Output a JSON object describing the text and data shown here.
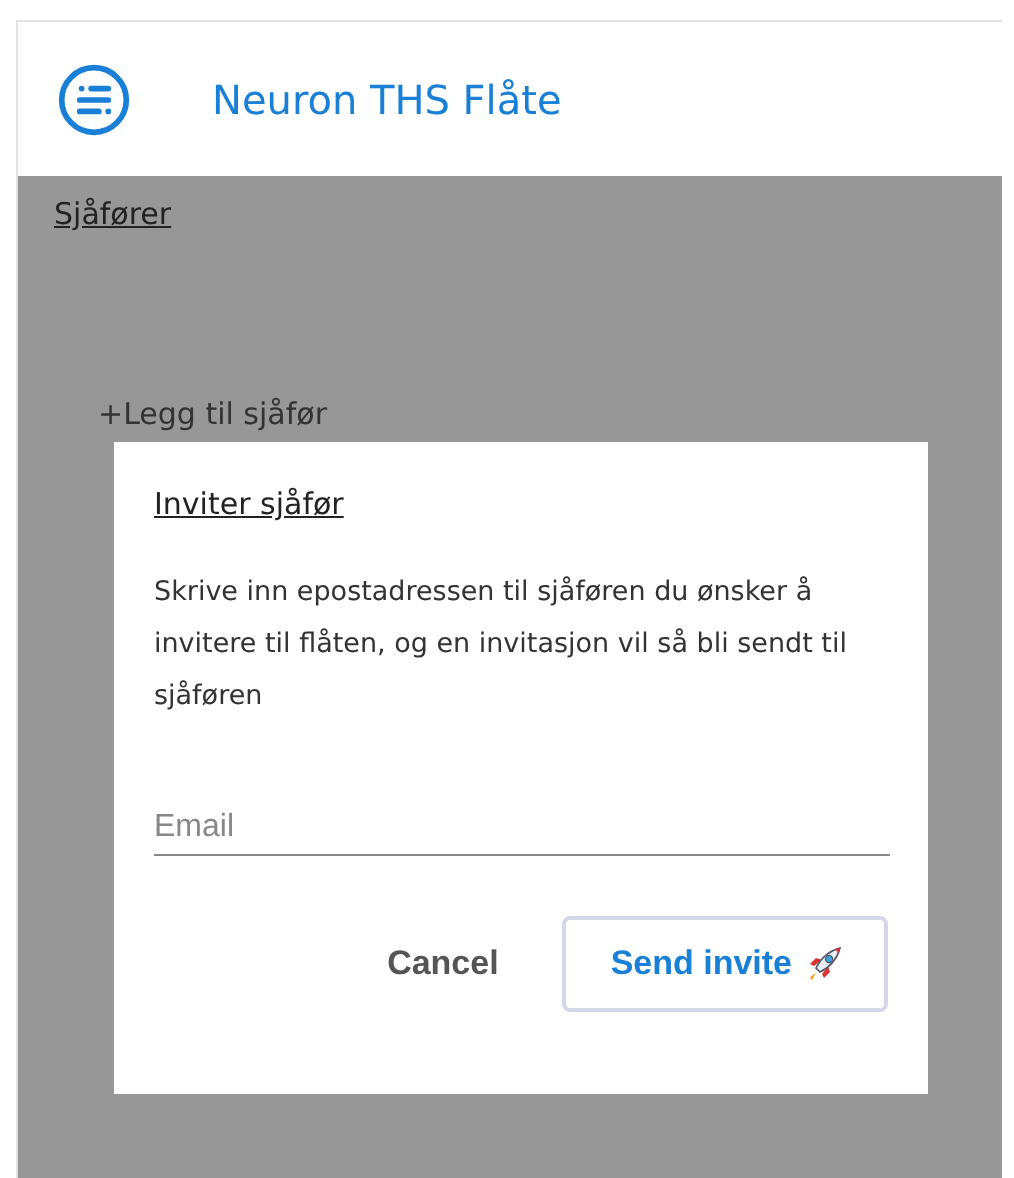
{
  "header": {
    "title": "Neuron THS Flåte"
  },
  "page": {
    "heading": "Sjåfører",
    "add_link": "+Legg til sjåfør"
  },
  "dialog": {
    "title": "Inviter sjåfør",
    "text": "Skrive inn epostadressen til sjåføren du ønsker å invitere til flåten, og en invitasjon vil så bli sendt til sjåføren",
    "email": {
      "placeholder": "Email"
    },
    "buttons": [
      {
        "label": "Cancel",
        "kind": "text"
      },
      {
        "label": "Send invite",
        "kind": "outlined"
      }
    ]
  }
}
